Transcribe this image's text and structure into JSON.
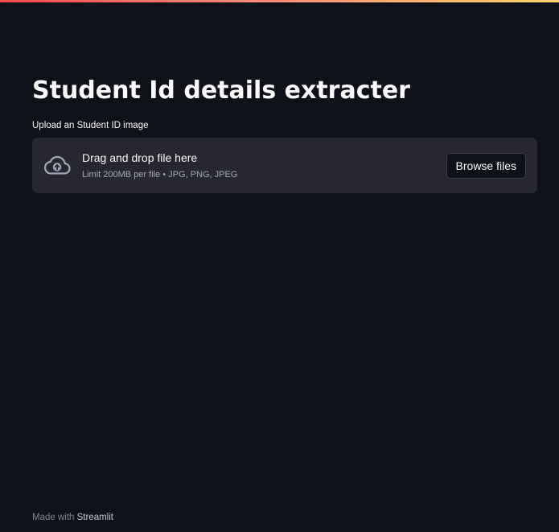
{
  "header": {
    "decoration_colors": [
      "#ff4b4b",
      "#ffd36b"
    ]
  },
  "main": {
    "title": "Student Id details extracter",
    "uploader": {
      "label": "Upload an Student ID image",
      "drag_text": "Drag and drop file here",
      "limit_text": "Limit 200MB per file • JPG, PNG, JPEG",
      "browse_label": "Browse files",
      "icon": "cloud-upload-icon"
    }
  },
  "footer": {
    "made_with": "Made with ",
    "link_text": "Streamlit"
  },
  "colors": {
    "background": "#0e1117",
    "dropzone": "#262730",
    "text": "#fafafa",
    "muted_text": "#a3a8b8"
  }
}
